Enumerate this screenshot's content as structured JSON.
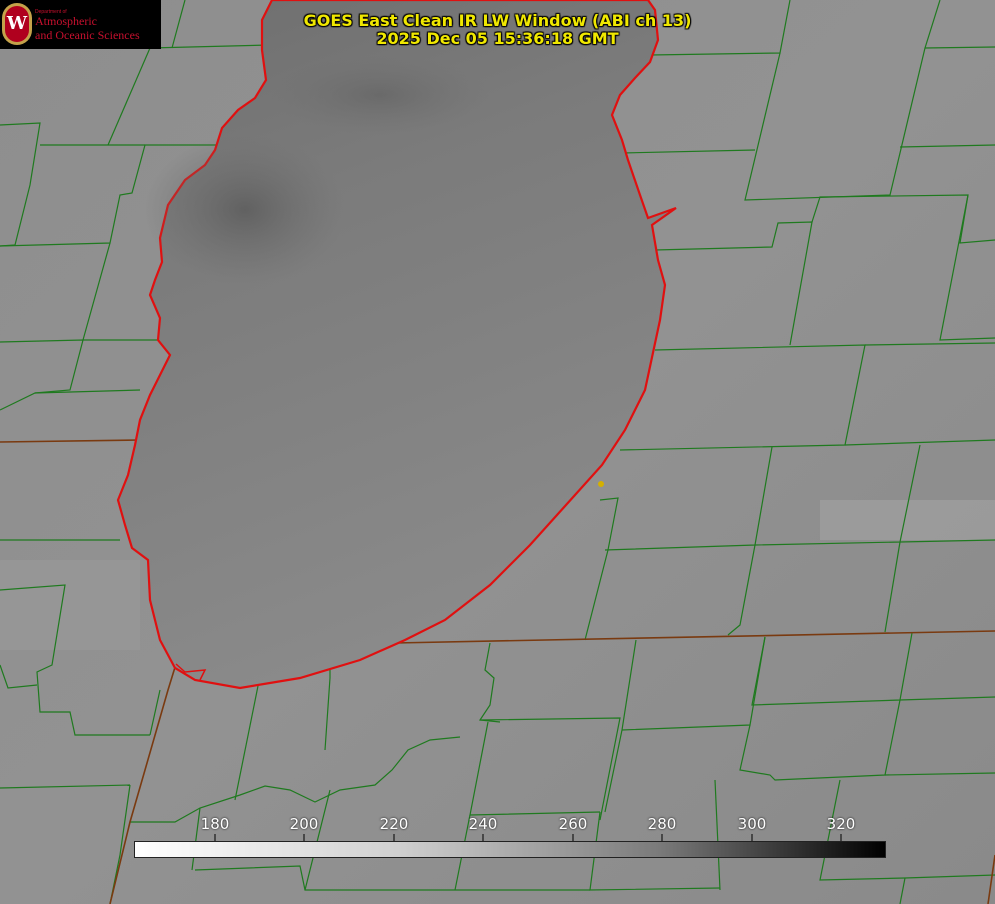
{
  "title": {
    "line1": "GOES East Clean IR LW Window (ABI ch 13)",
    "line2": "2025 Dec 05 15:36:18 GMT"
  },
  "logo": {
    "department": "Department of",
    "line1": "Atmospheric",
    "line2": "and Oceanic Sciences",
    "icon": "uw-crest-icon"
  },
  "colorbar": {
    "ticks": [
      "180",
      "200",
      "220",
      "240",
      "260",
      "280",
      "300",
      "320"
    ],
    "range": [
      162,
      330
    ]
  },
  "colors": {
    "county_lines": "#1f7a1f",
    "state_lines": "#7a3a10",
    "lake_outline": "#e01010",
    "title_text": "#f0e800",
    "marker": "#d4b000"
  }
}
